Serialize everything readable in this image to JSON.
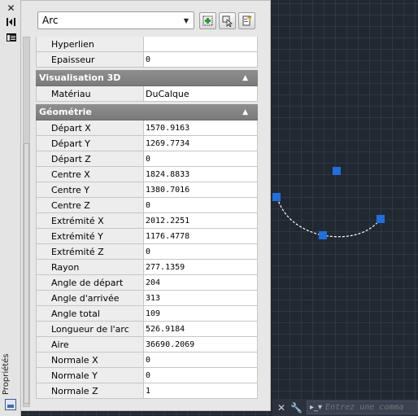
{
  "palette": {
    "title": "Propriétés",
    "object_type": "Arc"
  },
  "properties": {
    "general_tail": [
      {
        "name": "Hyperlien",
        "value": ""
      },
      {
        "name": "Epaisseur",
        "value": "0"
      }
    ],
    "section_3d": {
      "title": "Visualisation 3D",
      "rows": [
        {
          "name": "Matériau",
          "value": "DuCalque"
        }
      ]
    },
    "section_geometry": {
      "title": "Géométrie",
      "rows": [
        {
          "name": "Départ X",
          "value": "1570.9163"
        },
        {
          "name": "Départ Y",
          "value": "1269.7734"
        },
        {
          "name": "Départ Z",
          "value": "0"
        },
        {
          "name": "Centre X",
          "value": "1824.8833"
        },
        {
          "name": "Centre Y",
          "value": "1380.7016"
        },
        {
          "name": "Centre Z",
          "value": "0"
        },
        {
          "name": "Extrémité X",
          "value": "2012.2251"
        },
        {
          "name": "Extrémité Y",
          "value": "1176.4778"
        },
        {
          "name": "Extrémité Z",
          "value": "0"
        },
        {
          "name": "Rayon",
          "value": "277.1359"
        },
        {
          "name": "Angle de départ",
          "value": "204"
        },
        {
          "name": "Angle d'arrivée",
          "value": "313"
        },
        {
          "name": "Angle total",
          "value": "109"
        },
        {
          "name": "Longueur de l'arc",
          "value": "526.9184"
        },
        {
          "name": "Aire",
          "value": "36690.2069"
        },
        {
          "name": "Normale X",
          "value": "0"
        },
        {
          "name": "Normale Y",
          "value": "0"
        },
        {
          "name": "Normale Z",
          "value": "1"
        }
      ]
    }
  },
  "command_line": {
    "placeholder": "Entrez une comma"
  },
  "colors": {
    "grip": "#1e6fe0",
    "canvas": "#212830",
    "section_header": "#868686"
  }
}
